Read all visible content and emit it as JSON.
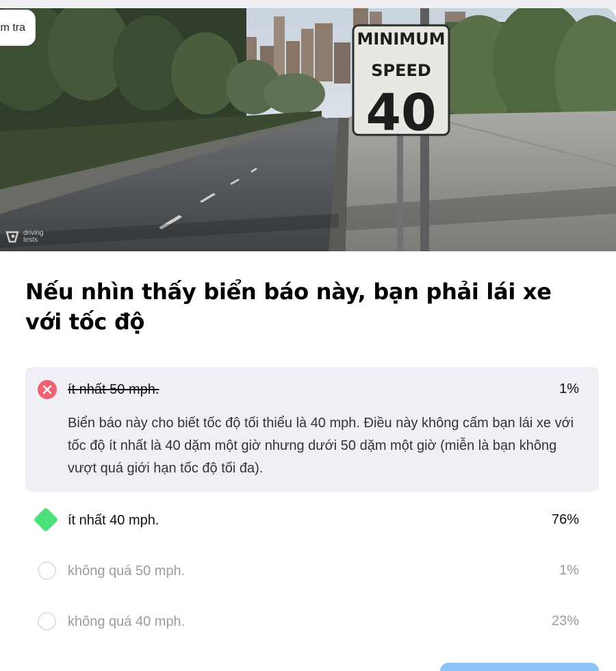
{
  "header": {
    "back_label": "m tra"
  },
  "hero": {
    "sign_line1": "MINIMUM",
    "sign_line2": "SPEED",
    "sign_number": "40",
    "watermark": "driving tests"
  },
  "question": {
    "text": "Nếu nhìn thấy biển báo này, bạn phải lái xe với tốc độ"
  },
  "answers": [
    {
      "label": "ít nhất 50 mph.",
      "percent": "1%",
      "state": "wrong",
      "explanation": "Biển báo này cho biết tốc độ tối thiểu là 40 mph. Điều này không cấm bạn lái xe với tốc độ ít nhất là 40 dặm một giờ nhưng dưới 50 dặm một giờ (miễn là bạn không vượt quá giới hạn tốc độ tối đa)."
    },
    {
      "label": "ít nhất 40 mph.",
      "percent": "76%",
      "state": "correct"
    },
    {
      "label": "không quá 50 mph.",
      "percent": "1%",
      "state": "unselected"
    },
    {
      "label": "không quá 40 mph.",
      "percent": "23%",
      "state": "unselected"
    }
  ],
  "colors": {
    "wrong": "#ef6270",
    "correct": "#4ce07a",
    "answer_bg": "#f0eff5",
    "button": "#8cc4f7"
  }
}
